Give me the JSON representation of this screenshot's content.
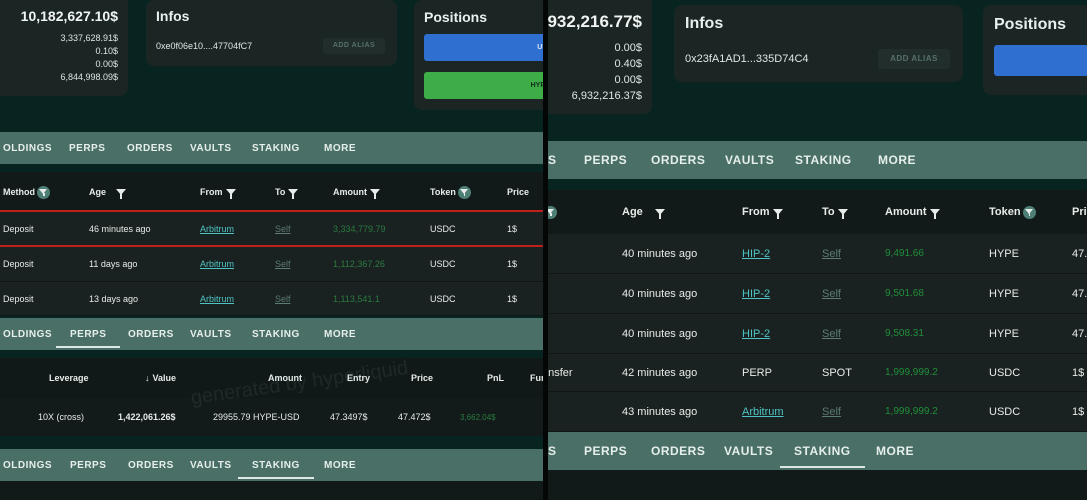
{
  "left": {
    "balances": {
      "total": "10,182,627.10$",
      "lines": [
        "3,337,628.91$",
        "0.10$",
        "0.00$",
        "6,844,998.09$"
      ]
    },
    "infos": {
      "title": "Infos",
      "address": "0xe0f06e10....47704fC7",
      "alias_button": "ADD ALIAS"
    },
    "positions": {
      "title": "Positions",
      "btn1": "USD",
      "btn2": "HYPE-"
    },
    "tabs_top": [
      "OLDINGS",
      "PERPS",
      "ORDERS",
      "VAULTS",
      "STAKING",
      "MORE"
    ],
    "history": {
      "headers": {
        "method": "Method",
        "age": "Age",
        "from": "From",
        "to": "To",
        "amount": "Amount",
        "token": "Token",
        "price": "Price"
      },
      "rows": [
        {
          "method": "Deposit",
          "age": "46 minutes ago",
          "from": "Arbitrum",
          "to": "Self",
          "amount": "3,334,779.79",
          "token": "USDC",
          "price": "1$"
        },
        {
          "method": "Deposit",
          "age": "11 days ago",
          "from": "Arbitrum",
          "to": "Self",
          "amount": "1,112,367.26",
          "token": "USDC",
          "price": "1$"
        },
        {
          "method": "Deposit",
          "age": "13 days ago",
          "from": "Arbitrum",
          "to": "Self",
          "amount": "1,113,541.1",
          "token": "USDC",
          "price": "1$"
        }
      ]
    },
    "tabs_mid": [
      "OLDINGS",
      "PERPS",
      "ORDERS",
      "VAULTS",
      "STAKING",
      "MORE"
    ],
    "perps": {
      "headers": {
        "leverage": "Leverage",
        "value": "Value",
        "amount": "Amount",
        "entry": "Entry",
        "price": "Price",
        "pnl": "PnL",
        "funding": "Fur"
      },
      "row": {
        "leverage": "10X (cross)",
        "value": "1,422,061.26$",
        "amount": "29955.79 HYPE-USD",
        "entry": "47.3497$",
        "price": "47.472$",
        "pnl": "3,662.04$"
      },
      "watermark": "generated by hyperliquid"
    },
    "tabs_bottom": [
      "OLDINGS",
      "PERPS",
      "ORDERS",
      "VAULTS",
      "STAKING",
      "MORE"
    ]
  },
  "right": {
    "balances": {
      "total": ",932,216.77$",
      "lines": [
        "0.00$",
        "0.40$",
        "0.00$",
        "6,932,216.37$"
      ]
    },
    "infos": {
      "title": "Infos",
      "address": "0x23fA1AD1...335D74C4",
      "alias_button": "ADD ALIAS"
    },
    "positions": {
      "title": "Positions"
    },
    "tabs_top": [
      "S",
      "PERPS",
      "ORDERS",
      "VAULTS",
      "STAKING",
      "MORE"
    ],
    "history": {
      "headers": {
        "age": "Age",
        "from": "From",
        "to": "To",
        "amount": "Amount",
        "token": "Token",
        "price": "Pri"
      },
      "rows": [
        {
          "method": "",
          "age": "40 minutes ago",
          "from": "HIP-2",
          "to": "Self",
          "amount": "9,491.66",
          "token": "HYPE",
          "price": "47."
        },
        {
          "method": "",
          "age": "40 minutes ago",
          "from": "HIP-2",
          "to": "Self",
          "amount": "9,501.68",
          "token": "HYPE",
          "price": "47."
        },
        {
          "method": "",
          "age": "40 minutes ago",
          "from": "HIP-2",
          "to": "Self",
          "amount": "9,508.31",
          "token": "HYPE",
          "price": "47."
        },
        {
          "method": "ansfer",
          "age": "42 minutes ago",
          "from": "PERP",
          "to": "SPOT",
          "amount": "1,999,999.2",
          "token": "USDC",
          "price": "1$"
        },
        {
          "method": "",
          "age": "43 minutes ago",
          "from": "Arbitrum",
          "to": "Self",
          "amount": "1,999,999.2",
          "token": "USDC",
          "price": "1$"
        }
      ]
    },
    "tabs_bottom": [
      "S",
      "PERPS",
      "ORDERS",
      "VAULTS",
      "STAKING",
      "MORE"
    ]
  },
  "colors": {
    "accent": "#4a6f66",
    "link": "#4fc3c3",
    "positive": "#1f8f3a",
    "alert": "#c0201c"
  }
}
